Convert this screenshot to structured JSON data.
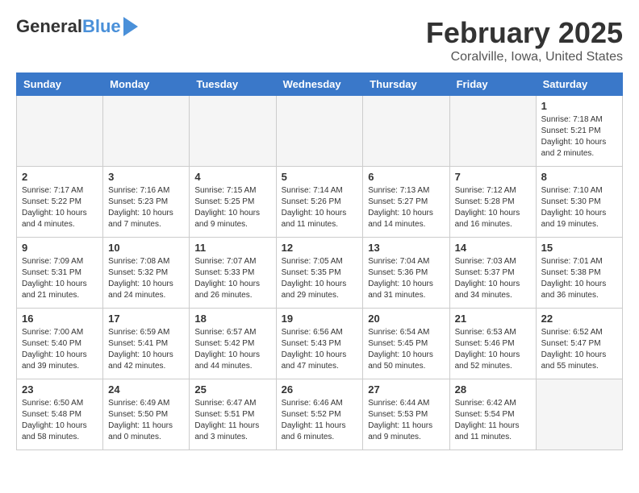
{
  "header": {
    "logo_general": "General",
    "logo_blue": "Blue",
    "month": "February 2025",
    "location": "Coralville, Iowa, United States"
  },
  "weekdays": [
    "Sunday",
    "Monday",
    "Tuesday",
    "Wednesday",
    "Thursday",
    "Friday",
    "Saturday"
  ],
  "weeks": [
    [
      {
        "day": "",
        "info": ""
      },
      {
        "day": "",
        "info": ""
      },
      {
        "day": "",
        "info": ""
      },
      {
        "day": "",
        "info": ""
      },
      {
        "day": "",
        "info": ""
      },
      {
        "day": "",
        "info": ""
      },
      {
        "day": "1",
        "info": "Sunrise: 7:18 AM\nSunset: 5:21 PM\nDaylight: 10 hours and 2 minutes."
      }
    ],
    [
      {
        "day": "2",
        "info": "Sunrise: 7:17 AM\nSunset: 5:22 PM\nDaylight: 10 hours and 4 minutes."
      },
      {
        "day": "3",
        "info": "Sunrise: 7:16 AM\nSunset: 5:23 PM\nDaylight: 10 hours and 7 minutes."
      },
      {
        "day": "4",
        "info": "Sunrise: 7:15 AM\nSunset: 5:25 PM\nDaylight: 10 hours and 9 minutes."
      },
      {
        "day": "5",
        "info": "Sunrise: 7:14 AM\nSunset: 5:26 PM\nDaylight: 10 hours and 11 minutes."
      },
      {
        "day": "6",
        "info": "Sunrise: 7:13 AM\nSunset: 5:27 PM\nDaylight: 10 hours and 14 minutes."
      },
      {
        "day": "7",
        "info": "Sunrise: 7:12 AM\nSunset: 5:28 PM\nDaylight: 10 hours and 16 minutes."
      },
      {
        "day": "8",
        "info": "Sunrise: 7:10 AM\nSunset: 5:30 PM\nDaylight: 10 hours and 19 minutes."
      }
    ],
    [
      {
        "day": "9",
        "info": "Sunrise: 7:09 AM\nSunset: 5:31 PM\nDaylight: 10 hours and 21 minutes."
      },
      {
        "day": "10",
        "info": "Sunrise: 7:08 AM\nSunset: 5:32 PM\nDaylight: 10 hours and 24 minutes."
      },
      {
        "day": "11",
        "info": "Sunrise: 7:07 AM\nSunset: 5:33 PM\nDaylight: 10 hours and 26 minutes."
      },
      {
        "day": "12",
        "info": "Sunrise: 7:05 AM\nSunset: 5:35 PM\nDaylight: 10 hours and 29 minutes."
      },
      {
        "day": "13",
        "info": "Sunrise: 7:04 AM\nSunset: 5:36 PM\nDaylight: 10 hours and 31 minutes."
      },
      {
        "day": "14",
        "info": "Sunrise: 7:03 AM\nSunset: 5:37 PM\nDaylight: 10 hours and 34 minutes."
      },
      {
        "day": "15",
        "info": "Sunrise: 7:01 AM\nSunset: 5:38 PM\nDaylight: 10 hours and 36 minutes."
      }
    ],
    [
      {
        "day": "16",
        "info": "Sunrise: 7:00 AM\nSunset: 5:40 PM\nDaylight: 10 hours and 39 minutes."
      },
      {
        "day": "17",
        "info": "Sunrise: 6:59 AM\nSunset: 5:41 PM\nDaylight: 10 hours and 42 minutes."
      },
      {
        "day": "18",
        "info": "Sunrise: 6:57 AM\nSunset: 5:42 PM\nDaylight: 10 hours and 44 minutes."
      },
      {
        "day": "19",
        "info": "Sunrise: 6:56 AM\nSunset: 5:43 PM\nDaylight: 10 hours and 47 minutes."
      },
      {
        "day": "20",
        "info": "Sunrise: 6:54 AM\nSunset: 5:45 PM\nDaylight: 10 hours and 50 minutes."
      },
      {
        "day": "21",
        "info": "Sunrise: 6:53 AM\nSunset: 5:46 PM\nDaylight: 10 hours and 52 minutes."
      },
      {
        "day": "22",
        "info": "Sunrise: 6:52 AM\nSunset: 5:47 PM\nDaylight: 10 hours and 55 minutes."
      }
    ],
    [
      {
        "day": "23",
        "info": "Sunrise: 6:50 AM\nSunset: 5:48 PM\nDaylight: 10 hours and 58 minutes."
      },
      {
        "day": "24",
        "info": "Sunrise: 6:49 AM\nSunset: 5:50 PM\nDaylight: 11 hours and 0 minutes."
      },
      {
        "day": "25",
        "info": "Sunrise: 6:47 AM\nSunset: 5:51 PM\nDaylight: 11 hours and 3 minutes."
      },
      {
        "day": "26",
        "info": "Sunrise: 6:46 AM\nSunset: 5:52 PM\nDaylight: 11 hours and 6 minutes."
      },
      {
        "day": "27",
        "info": "Sunrise: 6:44 AM\nSunset: 5:53 PM\nDaylight: 11 hours and 9 minutes."
      },
      {
        "day": "28",
        "info": "Sunrise: 6:42 AM\nSunset: 5:54 PM\nDaylight: 11 hours and 11 minutes."
      },
      {
        "day": "",
        "info": ""
      }
    ]
  ]
}
